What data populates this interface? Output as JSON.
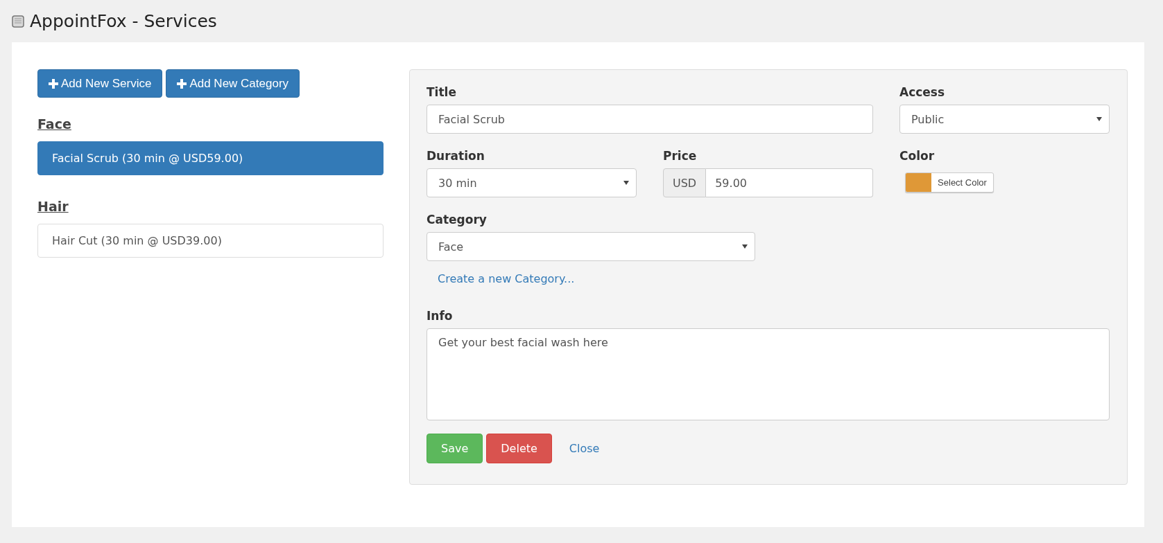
{
  "window": {
    "title": "AppointFox - Services"
  },
  "actions": [
    {
      "label": "Add New Service"
    },
    {
      "label": "Add New Category"
    }
  ],
  "categories": [
    {
      "name": "Face",
      "services": [
        {
          "label": "Facial Scrub (30 min @ USD59.00)",
          "selected": true
        }
      ]
    },
    {
      "name": "Hair",
      "services": [
        {
          "label": "Hair Cut (30 min @ USD39.00)",
          "selected": false
        }
      ]
    }
  ],
  "form": {
    "title": {
      "label": "Title",
      "value": "Facial Scrub"
    },
    "access": {
      "label": "Access",
      "value": "Public"
    },
    "duration": {
      "label": "Duration",
      "value": "30 min"
    },
    "price": {
      "label": "Price",
      "currency": "USD",
      "value": "59.00"
    },
    "color": {
      "label": "Color",
      "button": "Select Color",
      "color": "#df9837"
    },
    "category": {
      "label": "Category",
      "value": "Face",
      "link": "Create a new Category..."
    },
    "info": {
      "label": "Info",
      "value": "Get your best facial wash here"
    },
    "buttons": [
      {
        "label": "Save",
        "kind": "success"
      },
      {
        "label": "Delete",
        "kind": "danger"
      },
      {
        "label": "Close",
        "kind": "link"
      }
    ]
  }
}
